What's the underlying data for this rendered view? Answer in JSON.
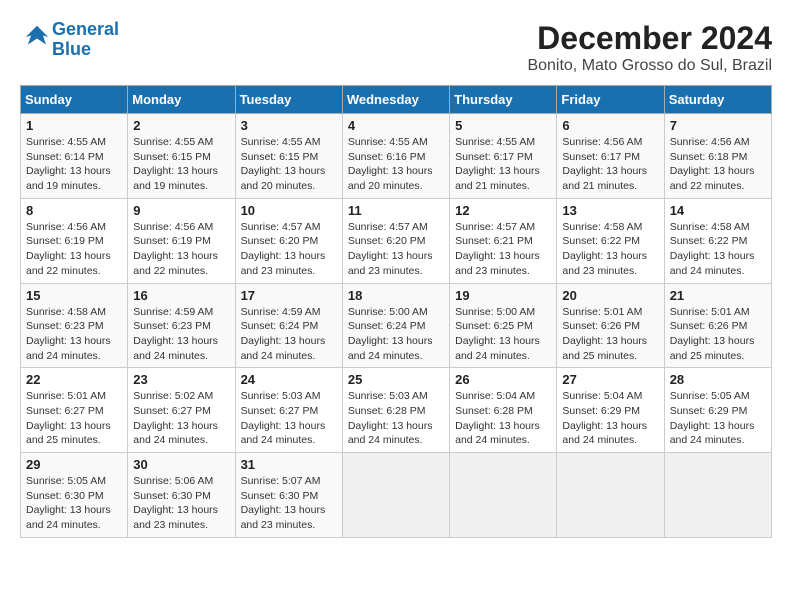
{
  "logo": {
    "line1": "General",
    "line2": "Blue"
  },
  "title": "December 2024",
  "subtitle": "Bonito, Mato Grosso do Sul, Brazil",
  "weekdays": [
    "Sunday",
    "Monday",
    "Tuesday",
    "Wednesday",
    "Thursday",
    "Friday",
    "Saturday"
  ],
  "weeks": [
    [
      {
        "day": "1",
        "sunrise": "4:55 AM",
        "sunset": "6:14 PM",
        "daylight": "13 hours and 19 minutes."
      },
      {
        "day": "2",
        "sunrise": "4:55 AM",
        "sunset": "6:15 PM",
        "daylight": "13 hours and 19 minutes."
      },
      {
        "day": "3",
        "sunrise": "4:55 AM",
        "sunset": "6:15 PM",
        "daylight": "13 hours and 20 minutes."
      },
      {
        "day": "4",
        "sunrise": "4:55 AM",
        "sunset": "6:16 PM",
        "daylight": "13 hours and 20 minutes."
      },
      {
        "day": "5",
        "sunrise": "4:55 AM",
        "sunset": "6:17 PM",
        "daylight": "13 hours and 21 minutes."
      },
      {
        "day": "6",
        "sunrise": "4:56 AM",
        "sunset": "6:17 PM",
        "daylight": "13 hours and 21 minutes."
      },
      {
        "day": "7",
        "sunrise": "4:56 AM",
        "sunset": "6:18 PM",
        "daylight": "13 hours and 22 minutes."
      }
    ],
    [
      {
        "day": "8",
        "sunrise": "4:56 AM",
        "sunset": "6:19 PM",
        "daylight": "13 hours and 22 minutes."
      },
      {
        "day": "9",
        "sunrise": "4:56 AM",
        "sunset": "6:19 PM",
        "daylight": "13 hours and 22 minutes."
      },
      {
        "day": "10",
        "sunrise": "4:57 AM",
        "sunset": "6:20 PM",
        "daylight": "13 hours and 23 minutes."
      },
      {
        "day": "11",
        "sunrise": "4:57 AM",
        "sunset": "6:20 PM",
        "daylight": "13 hours and 23 minutes."
      },
      {
        "day": "12",
        "sunrise": "4:57 AM",
        "sunset": "6:21 PM",
        "daylight": "13 hours and 23 minutes."
      },
      {
        "day": "13",
        "sunrise": "4:58 AM",
        "sunset": "6:22 PM",
        "daylight": "13 hours and 23 minutes."
      },
      {
        "day": "14",
        "sunrise": "4:58 AM",
        "sunset": "6:22 PM",
        "daylight": "13 hours and 24 minutes."
      }
    ],
    [
      {
        "day": "15",
        "sunrise": "4:58 AM",
        "sunset": "6:23 PM",
        "daylight": "13 hours and 24 minutes."
      },
      {
        "day": "16",
        "sunrise": "4:59 AM",
        "sunset": "6:23 PM",
        "daylight": "13 hours and 24 minutes."
      },
      {
        "day": "17",
        "sunrise": "4:59 AM",
        "sunset": "6:24 PM",
        "daylight": "13 hours and 24 minutes."
      },
      {
        "day": "18",
        "sunrise": "5:00 AM",
        "sunset": "6:24 PM",
        "daylight": "13 hours and 24 minutes."
      },
      {
        "day": "19",
        "sunrise": "5:00 AM",
        "sunset": "6:25 PM",
        "daylight": "13 hours and 24 minutes."
      },
      {
        "day": "20",
        "sunrise": "5:01 AM",
        "sunset": "6:26 PM",
        "daylight": "13 hours and 25 minutes."
      },
      {
        "day": "21",
        "sunrise": "5:01 AM",
        "sunset": "6:26 PM",
        "daylight": "13 hours and 25 minutes."
      }
    ],
    [
      {
        "day": "22",
        "sunrise": "5:01 AM",
        "sunset": "6:27 PM",
        "daylight": "13 hours and 25 minutes."
      },
      {
        "day": "23",
        "sunrise": "5:02 AM",
        "sunset": "6:27 PM",
        "daylight": "13 hours and 24 minutes."
      },
      {
        "day": "24",
        "sunrise": "5:03 AM",
        "sunset": "6:27 PM",
        "daylight": "13 hours and 24 minutes."
      },
      {
        "day": "25",
        "sunrise": "5:03 AM",
        "sunset": "6:28 PM",
        "daylight": "13 hours and 24 minutes."
      },
      {
        "day": "26",
        "sunrise": "5:04 AM",
        "sunset": "6:28 PM",
        "daylight": "13 hours and 24 minutes."
      },
      {
        "day": "27",
        "sunrise": "5:04 AM",
        "sunset": "6:29 PM",
        "daylight": "13 hours and 24 minutes."
      },
      {
        "day": "28",
        "sunrise": "5:05 AM",
        "sunset": "6:29 PM",
        "daylight": "13 hours and 24 minutes."
      }
    ],
    [
      {
        "day": "29",
        "sunrise": "5:05 AM",
        "sunset": "6:30 PM",
        "daylight": "13 hours and 24 minutes."
      },
      {
        "day": "30",
        "sunrise": "5:06 AM",
        "sunset": "6:30 PM",
        "daylight": "13 hours and 23 minutes."
      },
      {
        "day": "31",
        "sunrise": "5:07 AM",
        "sunset": "6:30 PM",
        "daylight": "13 hours and 23 minutes."
      },
      null,
      null,
      null,
      null
    ]
  ]
}
